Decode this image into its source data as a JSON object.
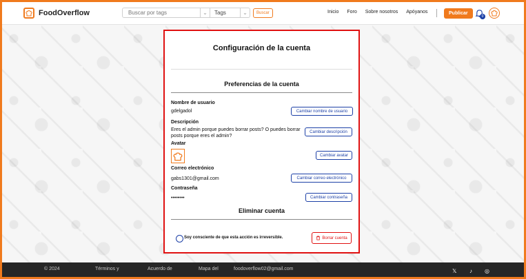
{
  "header": {
    "brand": "FoodOverflow",
    "search_placeholder": "Buscar por tags",
    "tags_label": "Tags",
    "search_button": "Buscar",
    "nav": [
      "Inicio",
      "Foro",
      "Sobre nosotros",
      "Apóyanos"
    ],
    "publish_button": "Publicar",
    "notification_count": "0"
  },
  "card": {
    "title": "Configuración de la cuenta",
    "preferences_title": "Preferencias de la cuenta",
    "username": {
      "label": "Nombre de usuario",
      "value": "gdelgadol",
      "button": "Cambiar nombre de usuario"
    },
    "description": {
      "label": "Descripción",
      "value": "Eres el admin porque puedes borrar posts? O puedes borrar posts porque eres el admin?",
      "button": "Cambiar descripción"
    },
    "avatar": {
      "label": "Avatar",
      "button": "Cambiar avatar"
    },
    "email": {
      "label": "Correo electrónico",
      "value": "gabs1301@gmail.com",
      "button": "Cambiar correo electrónico"
    },
    "password": {
      "label": "Contraseña",
      "value": "••••••••",
      "button": "Cambiar contraseña"
    },
    "delete_title": "Eliminar cuenta",
    "consent_text": "Soy consciente de que esta acción es irreversible.",
    "delete_button": "Borrar cuenta"
  },
  "footer": {
    "copyright": "© 2024",
    "terms": "Términos y",
    "agreement": "Acuerdo de",
    "sitemap": "Mapa del",
    "email": "foodoverflow02@gmail.com"
  },
  "colors": {
    "accent": "#f07a1d",
    "link": "#1b3fa6",
    "danger": "#e01010",
    "footer": "#262626"
  }
}
